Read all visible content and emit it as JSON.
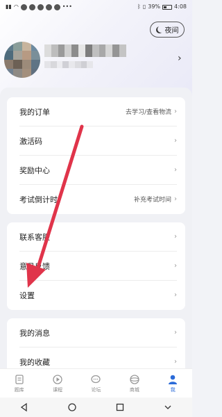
{
  "status_bar": {
    "battery": "39%",
    "time": "4:08"
  },
  "header": {
    "night_mode_label": "夜间"
  },
  "menu_group_1": [
    {
      "label": "我的订单",
      "value": "去学习/查看物流"
    },
    {
      "label": "激活码",
      "value": ""
    },
    {
      "label": "奖励中心",
      "value": ""
    },
    {
      "label": "考试倒计时",
      "value": "补充考试时间"
    }
  ],
  "menu_group_2": [
    {
      "label": "联系客服",
      "value": ""
    },
    {
      "label": "意见反馈",
      "value": ""
    },
    {
      "label": "设置",
      "value": ""
    }
  ],
  "menu_group_3": [
    {
      "label": "我的消息",
      "value": ""
    },
    {
      "label": "我的收藏",
      "value": ""
    }
  ],
  "tabbar": [
    {
      "label": "题库",
      "icon": "question-bank-icon"
    },
    {
      "label": "课程",
      "icon": "course-icon"
    },
    {
      "label": "论坛",
      "icon": "forum-icon"
    },
    {
      "label": "商城",
      "icon": "shop-icon"
    },
    {
      "label": "我",
      "icon": "profile-icon",
      "active": true
    }
  ],
  "colors": {
    "accent": "#2b6bd8",
    "annotation_arrow": "#e0344a"
  }
}
